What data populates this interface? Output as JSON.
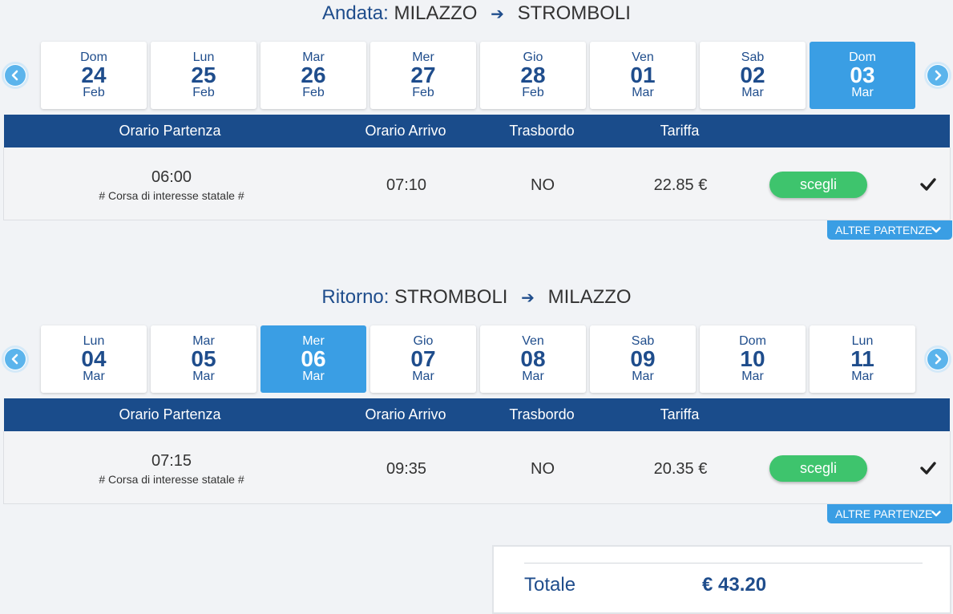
{
  "outbound": {
    "label": "Andata:",
    "from": "MILAZZO",
    "arrow": "➔",
    "to": "STROMBOLI",
    "days": [
      {
        "dow": "Dom",
        "num": "24",
        "mon": "Feb"
      },
      {
        "dow": "Lun",
        "num": "25",
        "mon": "Feb"
      },
      {
        "dow": "Mar",
        "num": "26",
        "mon": "Feb"
      },
      {
        "dow": "Mer",
        "num": "27",
        "mon": "Feb"
      },
      {
        "dow": "Gio",
        "num": "28",
        "mon": "Feb"
      },
      {
        "dow": "Ven",
        "num": "01",
        "mon": "Mar"
      },
      {
        "dow": "Sab",
        "num": "02",
        "mon": "Mar"
      },
      {
        "dow": "Dom",
        "num": "03",
        "mon": "Mar"
      }
    ],
    "selected_day": "Dom 03 Mar",
    "headers": {
      "departure": "Orario Partenza",
      "arrival": "Orario Arrivo",
      "transfer": "Trasbordo",
      "fare": "Tariffa"
    },
    "row": {
      "departure": "06:00",
      "note": "# Corsa di interesse statale #",
      "arrival": "07:10",
      "transfer": "NO",
      "fare": "22.85 €",
      "choose": "scegli"
    },
    "more": "ALTRE PARTENZE"
  },
  "return": {
    "label": "Ritorno:",
    "from": "STROMBOLI",
    "arrow": "➔",
    "to": "MILAZZO",
    "days": [
      {
        "dow": "Lun",
        "num": "04",
        "mon": "Mar"
      },
      {
        "dow": "Mar",
        "num": "05",
        "mon": "Mar"
      },
      {
        "dow": "Mer",
        "num": "06",
        "mon": "Mar"
      },
      {
        "dow": "Gio",
        "num": "07",
        "mon": "Mar"
      },
      {
        "dow": "Ven",
        "num": "08",
        "mon": "Mar"
      },
      {
        "dow": "Sab",
        "num": "09",
        "mon": "Mar"
      },
      {
        "dow": "Dom",
        "num": "10",
        "mon": "Mar"
      },
      {
        "dow": "Lun",
        "num": "11",
        "mon": "Mar"
      }
    ],
    "selected_day": "Mer 06 Mar",
    "headers": {
      "departure": "Orario Partenza",
      "arrival": "Orario Arrivo",
      "transfer": "Trasbordo",
      "fare": "Tariffa"
    },
    "row": {
      "departure": "07:15",
      "note": "# Corsa di interesse statale #",
      "arrival": "09:35",
      "transfer": "NO",
      "fare": "20.35 €",
      "choose": "scegli"
    },
    "more": "ALTRE PARTENZE"
  },
  "total": {
    "label": "Totale",
    "value": "€ 43.20"
  },
  "icons": {
    "prev": "chevron-left-icon",
    "next": "chevron-right-icon",
    "check": "check-icon",
    "more": "chevron-down-icon"
  },
  "colors": {
    "primary": "#1a4c8b",
    "accent": "#3a9ee4",
    "success": "#3ec46d",
    "nav": "#5bb4ec"
  }
}
